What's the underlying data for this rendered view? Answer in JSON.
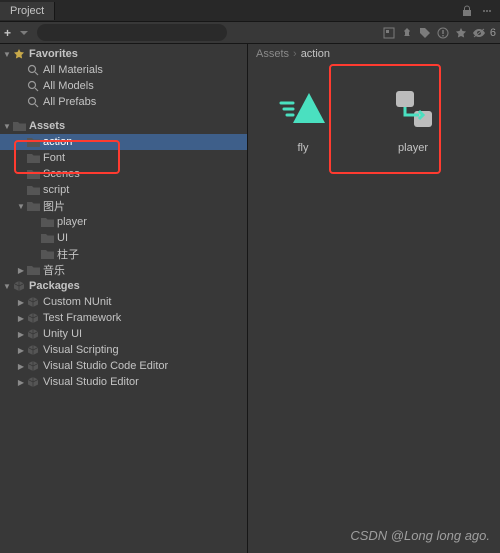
{
  "tab": {
    "title": "Project"
  },
  "toolbar": {
    "plus": "+",
    "search_value": "",
    "hidden_count": "6"
  },
  "breadcrumb": {
    "root": "Assets",
    "current": "action"
  },
  "tree": [
    {
      "label": "Favorites",
      "icon": "star",
      "depth": 0,
      "caret": "down",
      "bold": true
    },
    {
      "label": "All Materials",
      "icon": "search",
      "depth": 1
    },
    {
      "label": "All Models",
      "icon": "search",
      "depth": 1
    },
    {
      "label": "All Prefabs",
      "icon": "search",
      "depth": 1
    },
    {
      "spacer": true
    },
    {
      "label": "Assets",
      "icon": "folder",
      "depth": 0,
      "caret": "down",
      "bold": true
    },
    {
      "label": "action",
      "icon": "folder",
      "depth": 1,
      "selected": true
    },
    {
      "label": "Font",
      "icon": "folder",
      "depth": 1
    },
    {
      "label": "Scenes",
      "icon": "folder",
      "depth": 1
    },
    {
      "label": "script",
      "icon": "folder",
      "depth": 1
    },
    {
      "label": "图片",
      "icon": "folder",
      "depth": 1,
      "caret": "down"
    },
    {
      "label": "player",
      "icon": "folder",
      "depth": 2
    },
    {
      "label": "UI",
      "icon": "folder",
      "depth": 2
    },
    {
      "label": "柱子",
      "icon": "folder",
      "depth": 2
    },
    {
      "label": "音乐",
      "icon": "folder",
      "depth": 1,
      "caret": "right"
    },
    {
      "label": "Packages",
      "icon": "package",
      "depth": 0,
      "caret": "down",
      "bold": true
    },
    {
      "label": "Custom NUnit",
      "icon": "package",
      "depth": 1,
      "caret": "right"
    },
    {
      "label": "Test Framework",
      "icon": "package",
      "depth": 1,
      "caret": "right"
    },
    {
      "label": "Unity UI",
      "icon": "package",
      "depth": 1,
      "caret": "right"
    },
    {
      "label": "Visual Scripting",
      "icon": "package",
      "depth": 1,
      "caret": "right"
    },
    {
      "label": "Visual Studio Code Editor",
      "icon": "package",
      "depth": 1,
      "caret": "right"
    },
    {
      "label": "Visual Studio Editor",
      "icon": "package",
      "depth": 1,
      "caret": "right"
    }
  ],
  "grid_items": [
    {
      "name": "fly",
      "kind": "animation"
    },
    {
      "name": "player",
      "kind": "animator"
    }
  ],
  "watermark": "CSDN @Long long ago."
}
